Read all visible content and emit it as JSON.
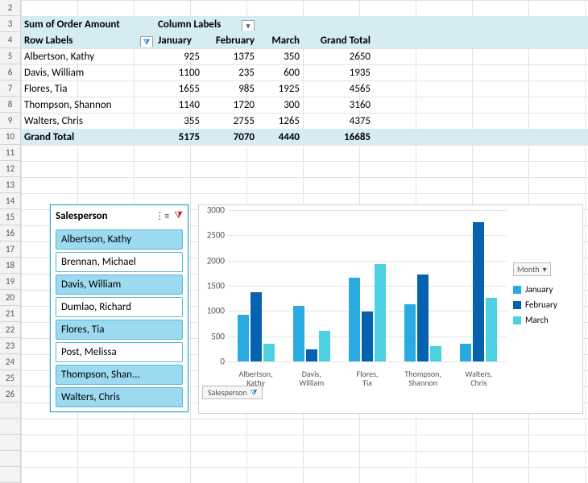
{
  "pivot": {
    "title": "Sum of Order Amount",
    "column_labels_label": "Column Labels",
    "row_labels_label": "Row Labels",
    "months": {
      "jan": "January",
      "feb": "February",
      "mar": "March"
    },
    "grand_total_label": "Grand Total",
    "rows": [
      {
        "name": "Albertson, Kathy",
        "jan": "925",
        "feb": "1375",
        "mar": "350",
        "gt": "2650"
      },
      {
        "name": "Davis, William",
        "jan": "1100",
        "feb": "235",
        "mar": "600",
        "gt": "1935"
      },
      {
        "name": "Flores, Tia",
        "jan": "1655",
        "feb": "985",
        "mar": "1925",
        "gt": "4565"
      },
      {
        "name": "Thompson, Shannon",
        "jan": "1140",
        "feb": "1720",
        "mar": "300",
        "gt": "3160"
      },
      {
        "name": "Walters, Chris",
        "jan": "355",
        "feb": "2755",
        "mar": "1265",
        "gt": "4375"
      }
    ],
    "totals": {
      "jan": "5175",
      "feb": "7070",
      "mar": "4440",
      "gt": "16685"
    }
  },
  "row_numbers": [
    "2",
    "3",
    "4",
    "5",
    "6",
    "7",
    "8",
    "9",
    "10",
    "11",
    "12",
    "13",
    "14",
    "15",
    "16",
    "17",
    "18",
    "19",
    "20",
    "21",
    "22",
    "23",
    "24",
    "25",
    "26"
  ],
  "slicer": {
    "title": "Salesperson",
    "items": [
      {
        "label": "Albertson, Kathy",
        "selected": true
      },
      {
        "label": "Brennan, Michael",
        "selected": false
      },
      {
        "label": "Davis, William",
        "selected": true
      },
      {
        "label": "Dumlao, Richard",
        "selected": false
      },
      {
        "label": "Flores, Tia",
        "selected": true
      },
      {
        "label": "Post, Melissa",
        "selected": false
      },
      {
        "label": "Thompson, Shan...",
        "selected": true
      },
      {
        "label": "Walters, Chris",
        "selected": true
      }
    ]
  },
  "chart": {
    "legend_button": "Month",
    "legend": {
      "jan": "January",
      "feb": "February",
      "mar": "March"
    },
    "field_button": "Salesperson",
    "y_ticks": [
      "0",
      "500",
      "1000",
      "1500",
      "2000",
      "2500",
      "3000"
    ]
  },
  "chart_data": {
    "type": "bar",
    "categories": [
      "Albertson, Kathy",
      "Davis, William",
      "Flores, Tia",
      "Thompson, Shannon",
      "Walters, Chris"
    ],
    "series": [
      {
        "name": "January",
        "values": [
          925,
          1100,
          1655,
          1140,
          355
        ]
      },
      {
        "name": "February",
        "values": [
          1375,
          235,
          985,
          1720,
          2755
        ]
      },
      {
        "name": "March",
        "values": [
          350,
          600,
          1925,
          300,
          1265
        ]
      }
    ],
    "ylim": [
      0,
      3000
    ],
    "xlabel": "",
    "ylabel": "",
    "title": ""
  },
  "colors": {
    "jan": "#29abe2",
    "feb": "#0562b0",
    "mar": "#4dd0e1",
    "highlight": "#d5ecf2"
  }
}
